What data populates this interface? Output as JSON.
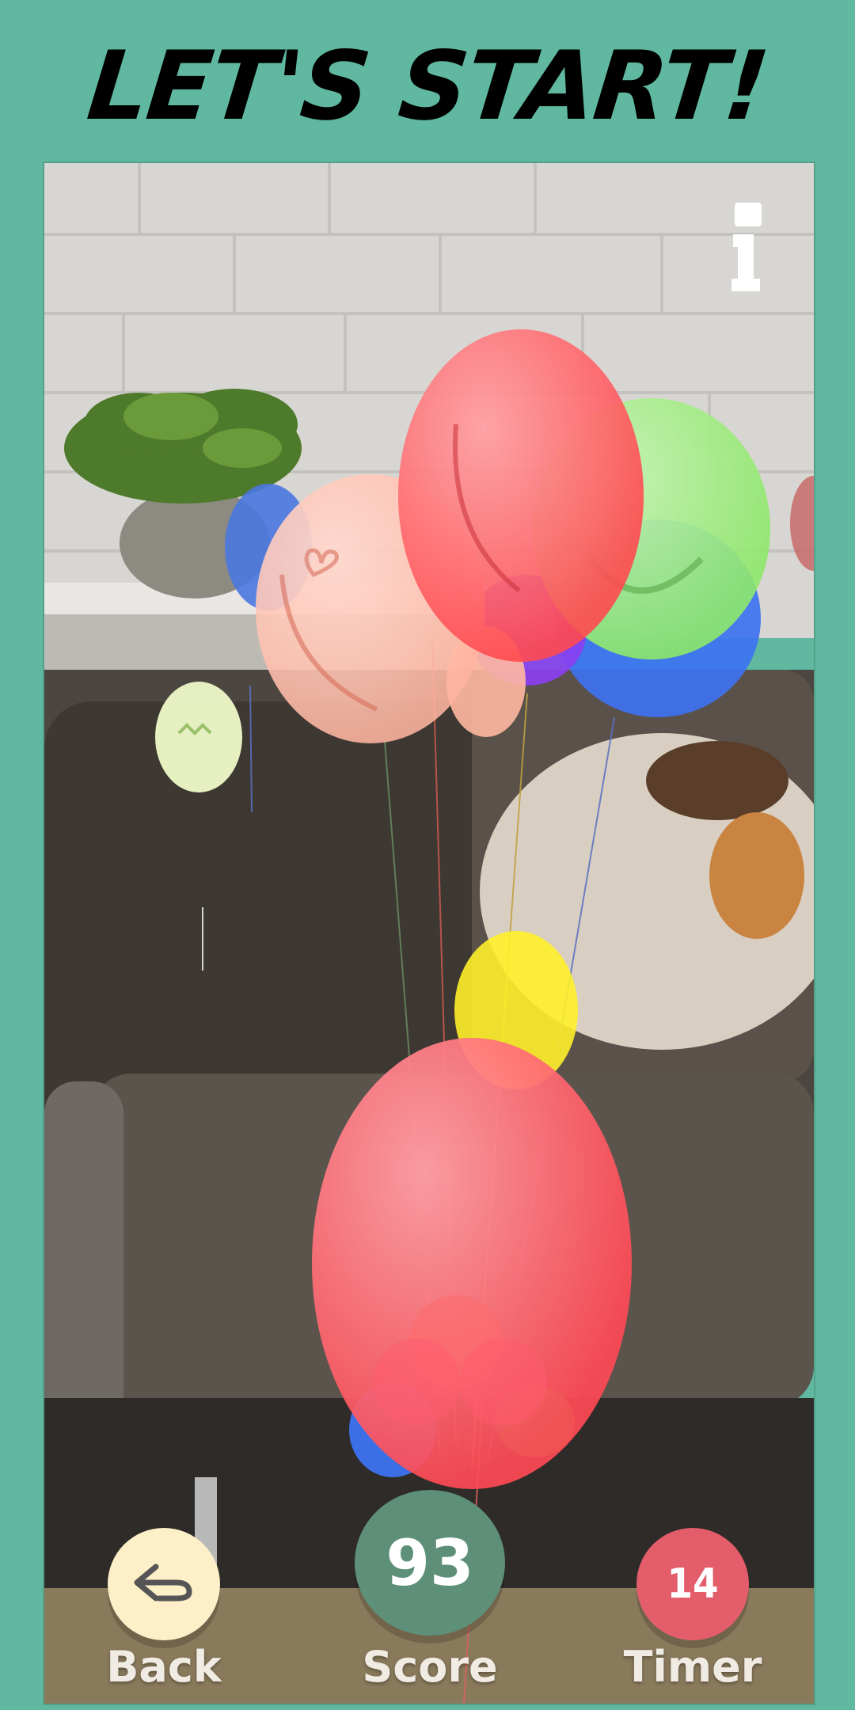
{
  "header": {
    "title": "LET'S START!"
  },
  "hud": {
    "back_label": "Back",
    "score_label": "Score",
    "score_value": "93",
    "timer_label": "Timer",
    "timer_value": "14"
  },
  "icons": {
    "info": "info-icon",
    "back": "back-arrow-icon"
  },
  "colors": {
    "background": "#5fb89f",
    "back_button": "#fdefc8",
    "score_button": "#5e8f78",
    "timer_button": "#e35d6a"
  }
}
